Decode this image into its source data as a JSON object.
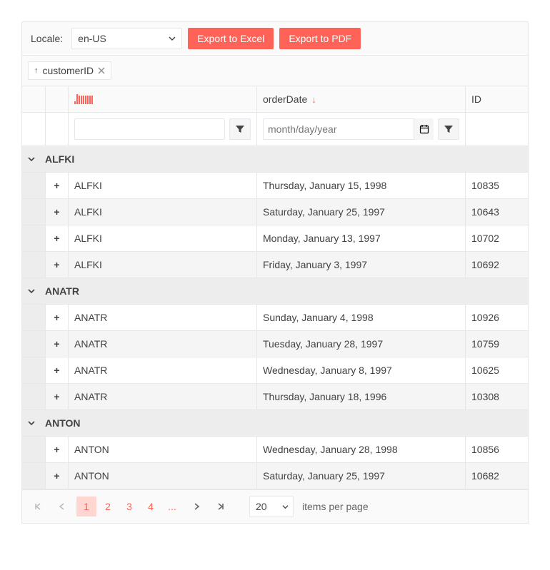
{
  "toolbar": {
    "locale_label": "Locale:",
    "locale_value": "en-US",
    "export_excel": "Export to Excel",
    "export_pdf": "Export to PDF"
  },
  "group_panel": {
    "field_label": "customerID"
  },
  "columns": {
    "spark": "",
    "orderDate": "orderDate",
    "id": "ID"
  },
  "filters": {
    "text_value": "",
    "date_placeholder": "month/day/year"
  },
  "groups": [
    {
      "key": "ALFKI",
      "rows": [
        {
          "cust": "ALFKI",
          "date": "Thursday, January 15, 1998",
          "id": "10835"
        },
        {
          "cust": "ALFKI",
          "date": "Saturday, January 25, 1997",
          "id": "10643"
        },
        {
          "cust": "ALFKI",
          "date": "Monday, January 13, 1997",
          "id": "10702"
        },
        {
          "cust": "ALFKI",
          "date": "Friday, January 3, 1997",
          "id": "10692"
        }
      ]
    },
    {
      "key": "ANATR",
      "rows": [
        {
          "cust": "ANATR",
          "date": "Sunday, January 4, 1998",
          "id": "10926"
        },
        {
          "cust": "ANATR",
          "date": "Tuesday, January 28, 1997",
          "id": "10759"
        },
        {
          "cust": "ANATR",
          "date": "Wednesday, January 8, 1997",
          "id": "10625"
        },
        {
          "cust": "ANATR",
          "date": "Thursday, January 18, 1996",
          "id": "10308"
        }
      ]
    },
    {
      "key": "ANTON",
      "rows": [
        {
          "cust": "ANTON",
          "date": "Wednesday, January 28, 1998",
          "id": "10856"
        },
        {
          "cust": "ANTON",
          "date": "Saturday, January 25, 1997",
          "id": "10682"
        }
      ]
    }
  ],
  "pager": {
    "pages": [
      "1",
      "2",
      "3",
      "4",
      "..."
    ],
    "page_size": "20",
    "info": "items per page"
  }
}
